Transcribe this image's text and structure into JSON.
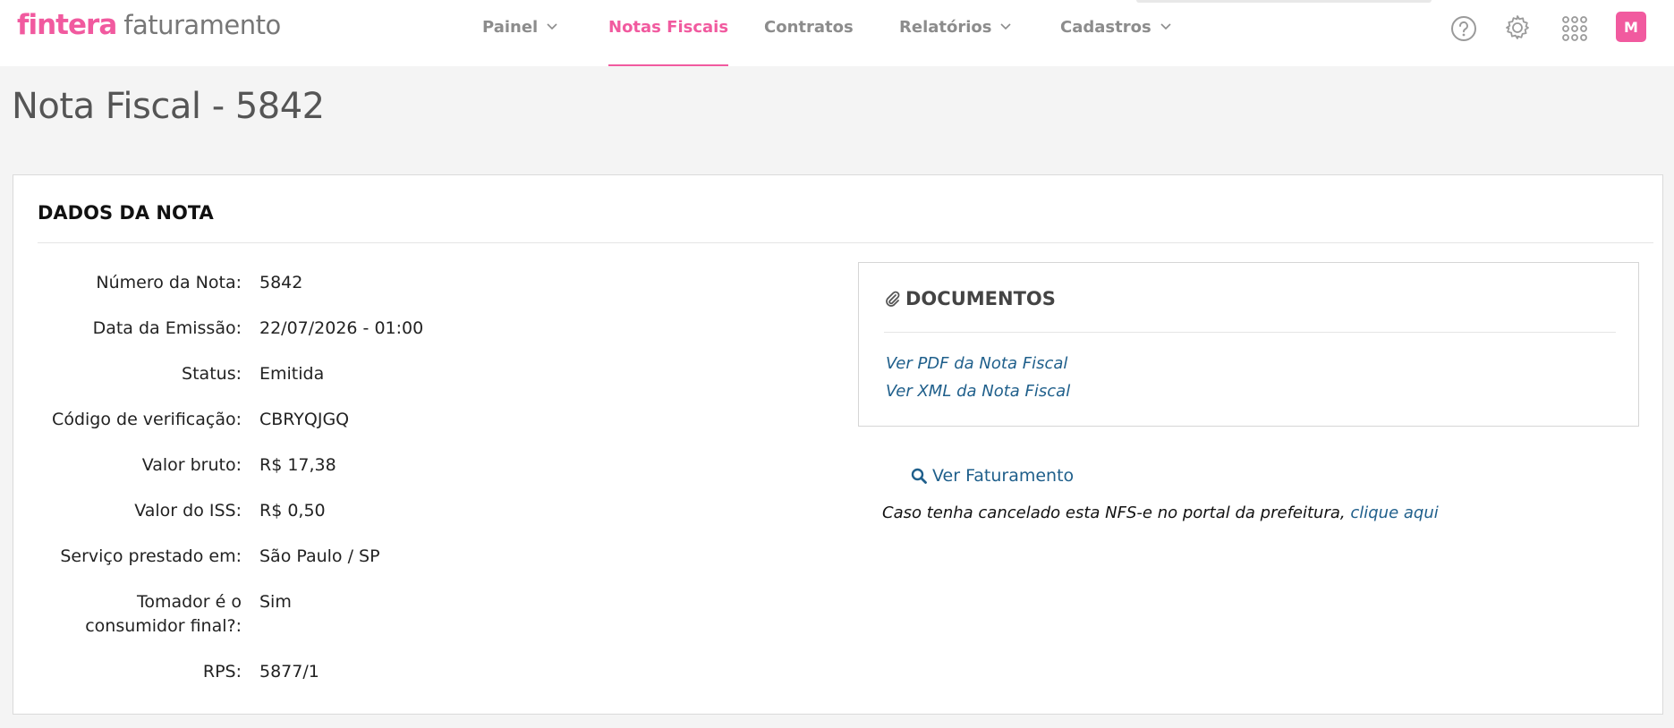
{
  "header": {
    "logo_brand": "fintera",
    "logo_product": "faturamento",
    "nav": [
      {
        "label": "Painel",
        "has_dropdown": true,
        "active": false
      },
      {
        "label": "Notas Fiscais",
        "has_dropdown": false,
        "active": true
      },
      {
        "label": "Contratos",
        "has_dropdown": false,
        "active": false
      },
      {
        "label": "Relatórios",
        "has_dropdown": true,
        "active": false
      },
      {
        "label": "Cadastros",
        "has_dropdown": true,
        "active": false
      }
    ],
    "icons": [
      "help-circle-icon",
      "gear-icon",
      "apps-grid-icon"
    ],
    "avatar_initial": "M"
  },
  "page": {
    "title": "Nota Fiscal - 5842"
  },
  "card": {
    "title": "DADOS DA NOTA",
    "fields": [
      {
        "label": "Número da Nota:",
        "value": "5842"
      },
      {
        "label": "Data da Emissão:",
        "value": "22/07/2026 - 01:00"
      },
      {
        "label": "Status:",
        "value": "Emitida"
      },
      {
        "label": "Código de verificação:",
        "value": "CBRYQJGQ"
      },
      {
        "label": "Valor bruto:",
        "value": "R$ 17,38"
      },
      {
        "label": "Valor do ISS:",
        "value": "R$ 0,50"
      },
      {
        "label": "Serviço prestado em:",
        "value": "São Paulo / SP"
      },
      {
        "label": "Tomador é o consumidor final?:",
        "value": "Sim"
      },
      {
        "label": "RPS:",
        "value": "5877/1"
      }
    ]
  },
  "documents": {
    "title": "DOCUMENTOS",
    "links": [
      {
        "label": "Ver PDF da Nota Fiscal"
      },
      {
        "label": "Ver XML da Nota Fiscal"
      }
    ]
  },
  "billing": {
    "view_label": "Ver Faturamento",
    "cancel_note": "Caso tenha cancelado esta NFS-e no portal da prefeitura,",
    "cancel_link": "clique aqui"
  },
  "colors": {
    "brand": "#f15a9f",
    "link": "#1f5f8b",
    "nav_inactive": "#8c8c8c"
  }
}
